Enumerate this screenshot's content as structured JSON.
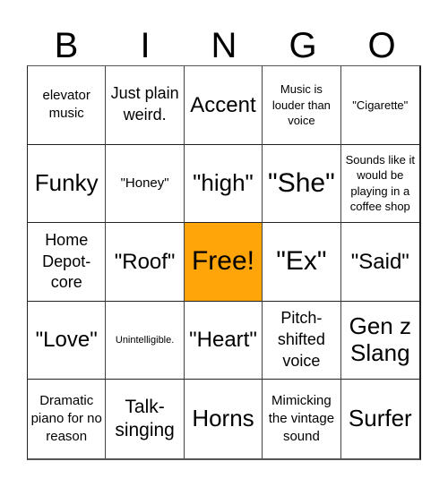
{
  "header": {
    "letters": [
      "B",
      "I",
      "N",
      "G",
      "O"
    ]
  },
  "board": {
    "free_color": "#ffa50a",
    "cells": [
      {
        "text": "elevator music",
        "free": false
      },
      {
        "text": "Just plain weird.",
        "free": false
      },
      {
        "text": "Accent",
        "free": false
      },
      {
        "text": "Music is louder than voice",
        "free": false
      },
      {
        "text": "\"Cigarette\"",
        "free": false
      },
      {
        "text": "Funky",
        "free": false
      },
      {
        "text": "\"Honey\"",
        "free": false
      },
      {
        "text": "\"high\"",
        "free": false
      },
      {
        "text": "\"She\"",
        "free": false
      },
      {
        "text": "Sounds like it would be playing in a coffee shop",
        "free": false
      },
      {
        "text": "Home Depot-core",
        "free": false
      },
      {
        "text": "\"Roof\"",
        "free": false
      },
      {
        "text": "Free!",
        "free": true
      },
      {
        "text": "\"Ex\"",
        "free": false
      },
      {
        "text": "\"Said\"",
        "free": false
      },
      {
        "text": "\"Love\"",
        "free": false
      },
      {
        "text": "Unintelligible.",
        "free": false
      },
      {
        "text": "\"Heart\"",
        "free": false
      },
      {
        "text": "Pitch-shifted voice",
        "free": false
      },
      {
        "text": "Gen z Slang",
        "free": false
      },
      {
        "text": "Dramatic piano for no reason",
        "free": false
      },
      {
        "text": "Talk-singing",
        "free": false
      },
      {
        "text": "Horns",
        "free": false
      },
      {
        "text": "Mimicking the vintage sound",
        "free": false
      },
      {
        "text": "Surfer",
        "free": false
      }
    ]
  }
}
